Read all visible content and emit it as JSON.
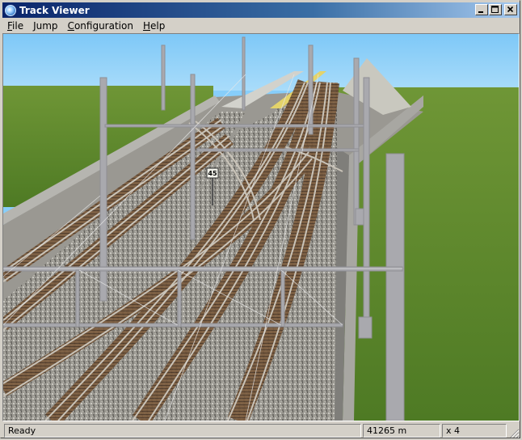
{
  "window": {
    "title": "Track Viewer"
  },
  "menu": [
    {
      "label": "File"
    },
    {
      "label": "Jump"
    },
    {
      "label": "Configuration"
    },
    {
      "label": "Help"
    }
  ],
  "scene": {
    "distance_marker": "45"
  },
  "status": {
    "message": "Ready",
    "distance": "41265 m",
    "speed": "x 4"
  },
  "colors": {
    "title_start": "#0a246a",
    "title_end": "#a6caf0",
    "sky": "#87cefa",
    "grass": "#5d8a2e",
    "ballast": "#9a9a94",
    "pole": "#a9a9ae"
  },
  "icons": {
    "app": "track-viewer-app-icon",
    "minimize": "minimize-icon",
    "maximize": "maximize-icon",
    "close": "close-icon"
  }
}
